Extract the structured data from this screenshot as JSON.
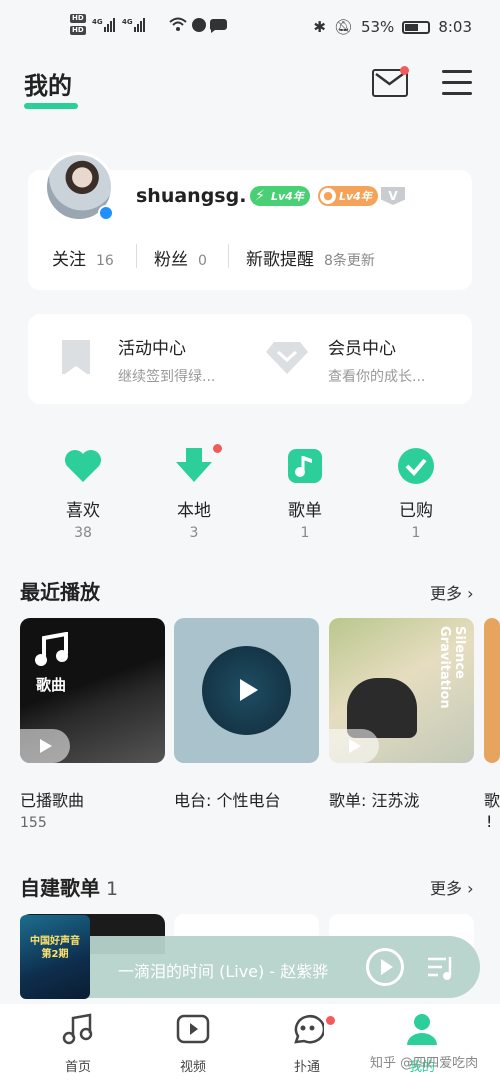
{
  "status_bar": {
    "left_indicators": "HD 4G 4G",
    "battery": "53%",
    "time": "8:03"
  },
  "header": {
    "title": "我的"
  },
  "profile": {
    "username": "shuangsg.",
    "badge_vip_level": "Lv4年",
    "badge_music_level": "Lv4年",
    "badge_v": "V",
    "stats": [
      {
        "label": "关注",
        "value": "16"
      },
      {
        "label": "粉丝",
        "value": "0"
      },
      {
        "label": "新歌提醒",
        "value": "8条更新"
      }
    ]
  },
  "activity": {
    "items": [
      {
        "title": "活动中心",
        "subtitle": "继续签到得绿..."
      },
      {
        "title": "会员中心",
        "subtitle": "查看你的成长..."
      }
    ]
  },
  "quick_actions": [
    {
      "label": "喜欢",
      "count": "38",
      "icon": "heart-icon"
    },
    {
      "label": "本地",
      "count": "3",
      "icon": "download-icon"
    },
    {
      "label": "歌单",
      "count": "1",
      "icon": "music-note-icon"
    },
    {
      "label": "已购",
      "count": "1",
      "icon": "check-icon"
    }
  ],
  "recent": {
    "title": "最近播放",
    "more": "更多",
    "tiles": [
      {
        "caption": "已播歌曲",
        "count": "155",
        "overlay": "歌曲"
      },
      {
        "caption": "电台: 个性电台"
      },
      {
        "caption": "歌单: 汪苏泷",
        "cover_text": "Silence Gravitation"
      },
      {
        "caption": "歌",
        "caption2": "!"
      }
    ]
  },
  "playlists": {
    "title": "自建歌单",
    "count": "1",
    "more": "更多"
  },
  "player": {
    "song": "一滴泪的时间 (Live) - 赵紫骅",
    "cover_text": "中国好声音 第2期"
  },
  "bottom_nav": [
    {
      "label": "首页",
      "icon": "music-note-icon"
    },
    {
      "label": "视频",
      "icon": "video-icon"
    },
    {
      "label": "扑通",
      "icon": "bubble-icon"
    },
    {
      "label": "我的",
      "icon": "user-icon"
    }
  ],
  "watermark": "知乎 @四四爱吃肉",
  "colors": {
    "accent": "#2ccf9a",
    "notification_dot": "#f25b5b",
    "badge_green": "#49d074",
    "badge_orange": "#f5a35b"
  }
}
